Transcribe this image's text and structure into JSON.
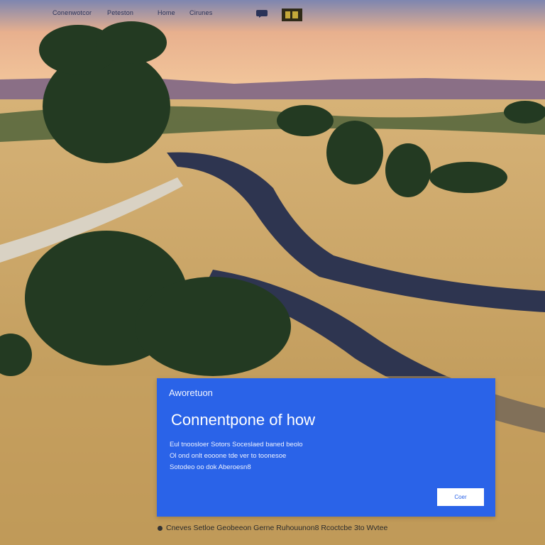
{
  "nav": {
    "links": [
      "Conenwotcor",
      "Peteston",
      "Home",
      "Cirunes"
    ],
    "icons": [
      "chat-icon",
      "grid-icon"
    ]
  },
  "panel": {
    "eyebrow": "Aworetuon",
    "title": "Connentpone of how",
    "body_lines": [
      "Eul tnoosloer Sotors Soceslaed baned beolo",
      "Ol ond onlt eooone tde ver to toonesoe",
      "Sotodeo oo dok Aberoesn8"
    ],
    "button_label": "Coer",
    "accent": "#2a63e8"
  },
  "footer": {
    "text": "Cneves Setloe Geobeeon Gerne Ruhouunon8 Rcoctcbe 3to Wvtee"
  }
}
